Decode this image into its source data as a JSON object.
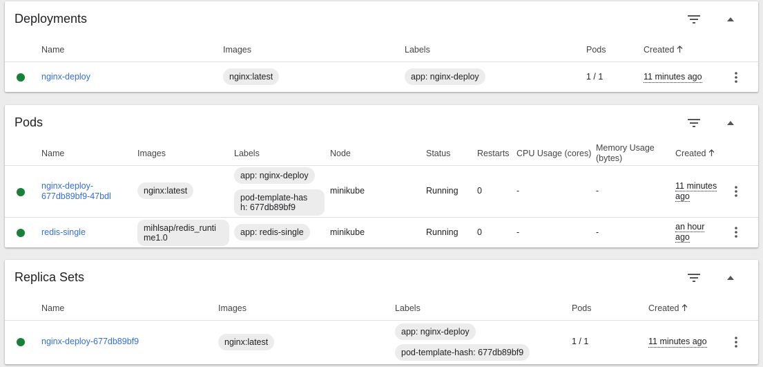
{
  "deployments": {
    "title": "Deployments",
    "columns": {
      "name": "Name",
      "images": "Images",
      "labels": "Labels",
      "pods": "Pods",
      "created": "Created"
    },
    "rows": [
      {
        "name": "nginx-deploy",
        "image": "nginx:latest",
        "label": "app: nginx-deploy",
        "pods": "1 / 1",
        "created": "11 minutes ago"
      }
    ]
  },
  "pods": {
    "title": "Pods",
    "columns": {
      "name": "Name",
      "images": "Images",
      "labels": "Labels",
      "node": "Node",
      "status": "Status",
      "restarts": "Restarts",
      "cpu": "CPU Usage (cores)",
      "memory_line1": "Memory Usage",
      "memory_line2": "(bytes)",
      "created": "Created"
    },
    "rows": [
      {
        "name_line1": "nginx-deploy-",
        "name_line2": "677db89bf9-47bdl",
        "image": "nginx:latest",
        "label1": "app: nginx-deploy",
        "label2_line1": "pod-template-has",
        "label2_line2": "h: 677db89bf9",
        "node": "minikube",
        "status": "Running",
        "restarts": "0",
        "cpu": "-",
        "memory": "-",
        "created_line1": "11 minutes",
        "created_line2": "ago"
      },
      {
        "name": "redis-single",
        "image_line1": "mihlsap/redis_runti",
        "image_line2": "me1.0",
        "label1": "app: redis-single",
        "node": "minikube",
        "status": "Running",
        "restarts": "0",
        "cpu": "-",
        "memory": "-",
        "created_line1": "an hour",
        "created_line2": "ago"
      }
    ]
  },
  "replica_sets": {
    "title": "Replica Sets",
    "columns": {
      "name": "Name",
      "images": "Images",
      "labels": "Labels",
      "pods": "Pods",
      "created": "Created"
    },
    "rows": [
      {
        "name": "nginx-deploy-677db89bf9",
        "image": "nginx:latest",
        "label1": "app: nginx-deploy",
        "label2": "pod-template-hash: 677db89bf9",
        "pods": "1 / 1",
        "created": "11 minutes ago"
      }
    ]
  },
  "icons": {
    "filter": "filter-icon",
    "collapse": "expand-less-icon",
    "menu": "more-vert-icon",
    "sort": "arrow-upward-icon",
    "status": "status-running-dot"
  },
  "colors": {
    "link": "#326de6",
    "status_ok": "#188038",
    "chip_bg": "#ececec"
  }
}
